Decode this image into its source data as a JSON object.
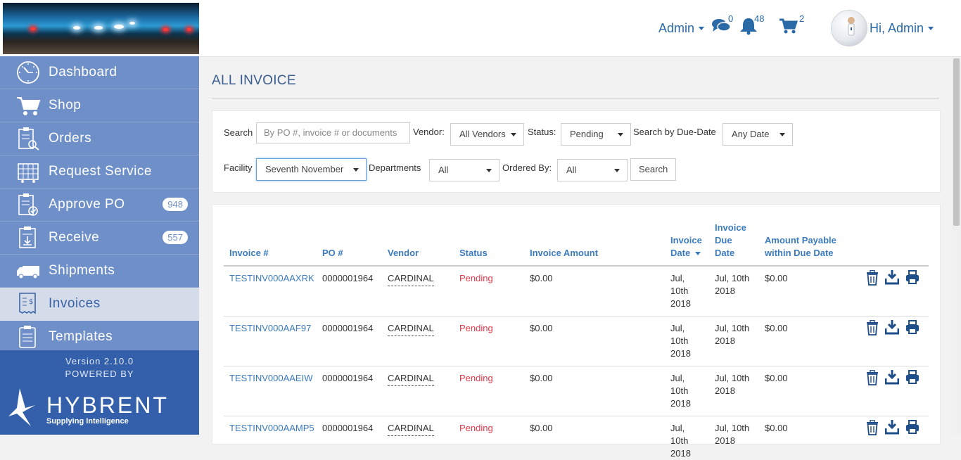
{
  "header": {
    "admin_menu": "Admin",
    "messages_count": "0",
    "notifications_count": "48",
    "cart_count": "2",
    "greeting": "Hi, Admin"
  },
  "sidebar": {
    "items": [
      {
        "label": "Dashboard",
        "icon": "dashboard-icon"
      },
      {
        "label": "Shop",
        "icon": "cart-icon"
      },
      {
        "label": "Orders",
        "icon": "orders-icon"
      },
      {
        "label": "Request Service",
        "icon": "request-service-icon"
      },
      {
        "label": "Approve PO",
        "icon": "approve-po-icon",
        "badge": "948"
      },
      {
        "label": "Receive",
        "icon": "receive-icon",
        "badge": "557"
      },
      {
        "label": "Shipments",
        "icon": "truck-icon"
      },
      {
        "label": "Invoices",
        "icon": "invoice-icon",
        "active": true
      },
      {
        "label": "Templates",
        "icon": "templates-icon"
      }
    ],
    "version": "Version 2.10.0",
    "powered_by": "POWERED BY",
    "brand": "HYBRENT",
    "tagline": "Supplying Intelligence"
  },
  "page": {
    "title": "ALL INVOICE"
  },
  "filters": {
    "search_label": "Search",
    "search_placeholder": "By PO #, invoice # or documents",
    "vendor_label": "Vendor:",
    "vendor_value": "All Vendors",
    "status_label": "Status:",
    "status_value": "Pending",
    "due_date_label": "Search by Due-Date",
    "due_date_value": "Any Date",
    "facility_label": "Facility",
    "facility_value": "Seventh November",
    "departments_label": "Departments",
    "departments_value": "All",
    "ordered_by_label": "Ordered By:",
    "ordered_by_value": "All",
    "search_button": "Search"
  },
  "table": {
    "headers": {
      "invoice_no": "Invoice #",
      "po_no": "PO #",
      "vendor": "Vendor",
      "status": "Status",
      "invoice_amount": "Invoice Amount",
      "invoice_date": [
        "Invoice",
        "Date"
      ],
      "due_date": [
        "Invoice",
        "Due",
        "Date"
      ],
      "amount_payable": [
        "Amount Payable",
        "within Due Date"
      ]
    },
    "rows": [
      {
        "invoice": "TESTINV000AAXRK",
        "po": "0000001964",
        "vendor": "CARDINAL",
        "status": "Pending",
        "amount": "$0.00",
        "invoice_date": [
          "Jul,",
          "10th",
          "2018"
        ],
        "due_date": [
          "Jul, 10th",
          "2018"
        ],
        "payable": "$0.00"
      },
      {
        "invoice": "TESTINV000AAF97",
        "po": "0000001964",
        "vendor": "CARDINAL",
        "status": "Pending",
        "amount": "$0.00",
        "invoice_date": [
          "Jul,",
          "10th",
          "2018"
        ],
        "due_date": [
          "Jul, 10th",
          "2018"
        ],
        "payable": "$0.00"
      },
      {
        "invoice": "TESTINV000AAEIW",
        "po": "0000001964",
        "vendor": "CARDINAL",
        "status": "Pending",
        "amount": "$0.00",
        "invoice_date": [
          "Jul,",
          "10th",
          "2018"
        ],
        "due_date": [
          "Jul, 10th",
          "2018"
        ],
        "payable": "$0.00"
      },
      {
        "invoice": "TESTINV000AAMP5",
        "po": "0000001964",
        "vendor": "CARDINAL",
        "status": "Pending",
        "amount": "$0.00",
        "invoice_date": [
          "Jul,",
          "10th",
          "2018"
        ],
        "due_date": [
          "Jul, 10th",
          "2018"
        ],
        "payable": "$0.00"
      }
    ]
  },
  "colors": {
    "sidebar": "#6f8fc8",
    "sidebar_footer": "#3460ab",
    "link": "#3b7bbf",
    "pending": "#e0384a"
  }
}
